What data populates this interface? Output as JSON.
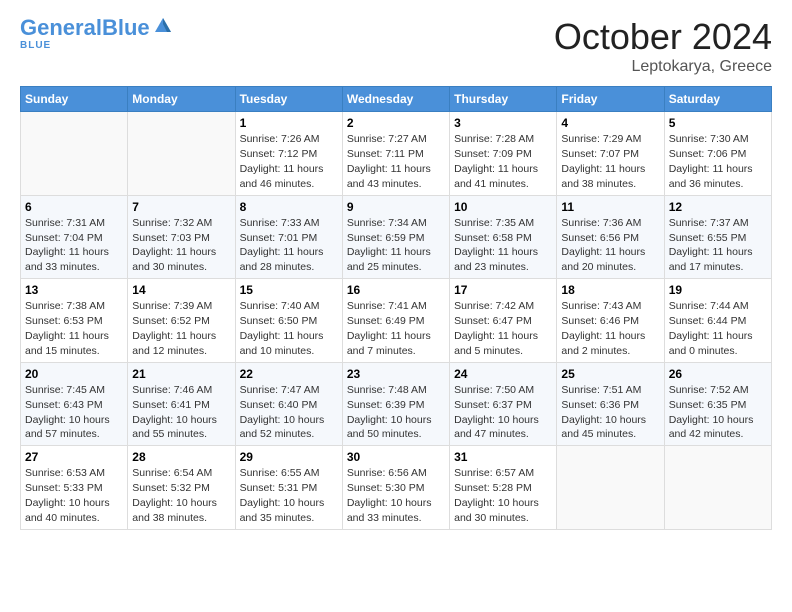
{
  "header": {
    "logo_general": "General",
    "logo_blue": "Blue",
    "month": "October 2024",
    "location": "Leptokarya, Greece"
  },
  "weekdays": [
    "Sunday",
    "Monday",
    "Tuesday",
    "Wednesday",
    "Thursday",
    "Friday",
    "Saturday"
  ],
  "weeks": [
    [
      {
        "day": "",
        "info": ""
      },
      {
        "day": "",
        "info": ""
      },
      {
        "day": "1",
        "info": "Sunrise: 7:26 AM\nSunset: 7:12 PM\nDaylight: 11 hours and 46 minutes."
      },
      {
        "day": "2",
        "info": "Sunrise: 7:27 AM\nSunset: 7:11 PM\nDaylight: 11 hours and 43 minutes."
      },
      {
        "day": "3",
        "info": "Sunrise: 7:28 AM\nSunset: 7:09 PM\nDaylight: 11 hours and 41 minutes."
      },
      {
        "day": "4",
        "info": "Sunrise: 7:29 AM\nSunset: 7:07 PM\nDaylight: 11 hours and 38 minutes."
      },
      {
        "day": "5",
        "info": "Sunrise: 7:30 AM\nSunset: 7:06 PM\nDaylight: 11 hours and 36 minutes."
      }
    ],
    [
      {
        "day": "6",
        "info": "Sunrise: 7:31 AM\nSunset: 7:04 PM\nDaylight: 11 hours and 33 minutes."
      },
      {
        "day": "7",
        "info": "Sunrise: 7:32 AM\nSunset: 7:03 PM\nDaylight: 11 hours and 30 minutes."
      },
      {
        "day": "8",
        "info": "Sunrise: 7:33 AM\nSunset: 7:01 PM\nDaylight: 11 hours and 28 minutes."
      },
      {
        "day": "9",
        "info": "Sunrise: 7:34 AM\nSunset: 6:59 PM\nDaylight: 11 hours and 25 minutes."
      },
      {
        "day": "10",
        "info": "Sunrise: 7:35 AM\nSunset: 6:58 PM\nDaylight: 11 hours and 23 minutes."
      },
      {
        "day": "11",
        "info": "Sunrise: 7:36 AM\nSunset: 6:56 PM\nDaylight: 11 hours and 20 minutes."
      },
      {
        "day": "12",
        "info": "Sunrise: 7:37 AM\nSunset: 6:55 PM\nDaylight: 11 hours and 17 minutes."
      }
    ],
    [
      {
        "day": "13",
        "info": "Sunrise: 7:38 AM\nSunset: 6:53 PM\nDaylight: 11 hours and 15 minutes."
      },
      {
        "day": "14",
        "info": "Sunrise: 7:39 AM\nSunset: 6:52 PM\nDaylight: 11 hours and 12 minutes."
      },
      {
        "day": "15",
        "info": "Sunrise: 7:40 AM\nSunset: 6:50 PM\nDaylight: 11 hours and 10 minutes."
      },
      {
        "day": "16",
        "info": "Sunrise: 7:41 AM\nSunset: 6:49 PM\nDaylight: 11 hours and 7 minutes."
      },
      {
        "day": "17",
        "info": "Sunrise: 7:42 AM\nSunset: 6:47 PM\nDaylight: 11 hours and 5 minutes."
      },
      {
        "day": "18",
        "info": "Sunrise: 7:43 AM\nSunset: 6:46 PM\nDaylight: 11 hours and 2 minutes."
      },
      {
        "day": "19",
        "info": "Sunrise: 7:44 AM\nSunset: 6:44 PM\nDaylight: 11 hours and 0 minutes."
      }
    ],
    [
      {
        "day": "20",
        "info": "Sunrise: 7:45 AM\nSunset: 6:43 PM\nDaylight: 10 hours and 57 minutes."
      },
      {
        "day": "21",
        "info": "Sunrise: 7:46 AM\nSunset: 6:41 PM\nDaylight: 10 hours and 55 minutes."
      },
      {
        "day": "22",
        "info": "Sunrise: 7:47 AM\nSunset: 6:40 PM\nDaylight: 10 hours and 52 minutes."
      },
      {
        "day": "23",
        "info": "Sunrise: 7:48 AM\nSunset: 6:39 PM\nDaylight: 10 hours and 50 minutes."
      },
      {
        "day": "24",
        "info": "Sunrise: 7:50 AM\nSunset: 6:37 PM\nDaylight: 10 hours and 47 minutes."
      },
      {
        "day": "25",
        "info": "Sunrise: 7:51 AM\nSunset: 6:36 PM\nDaylight: 10 hours and 45 minutes."
      },
      {
        "day": "26",
        "info": "Sunrise: 7:52 AM\nSunset: 6:35 PM\nDaylight: 10 hours and 42 minutes."
      }
    ],
    [
      {
        "day": "27",
        "info": "Sunrise: 6:53 AM\nSunset: 5:33 PM\nDaylight: 10 hours and 40 minutes."
      },
      {
        "day": "28",
        "info": "Sunrise: 6:54 AM\nSunset: 5:32 PM\nDaylight: 10 hours and 38 minutes."
      },
      {
        "day": "29",
        "info": "Sunrise: 6:55 AM\nSunset: 5:31 PM\nDaylight: 10 hours and 35 minutes."
      },
      {
        "day": "30",
        "info": "Sunrise: 6:56 AM\nSunset: 5:30 PM\nDaylight: 10 hours and 33 minutes."
      },
      {
        "day": "31",
        "info": "Sunrise: 6:57 AM\nSunset: 5:28 PM\nDaylight: 10 hours and 30 minutes."
      },
      {
        "day": "",
        "info": ""
      },
      {
        "day": "",
        "info": ""
      }
    ]
  ]
}
